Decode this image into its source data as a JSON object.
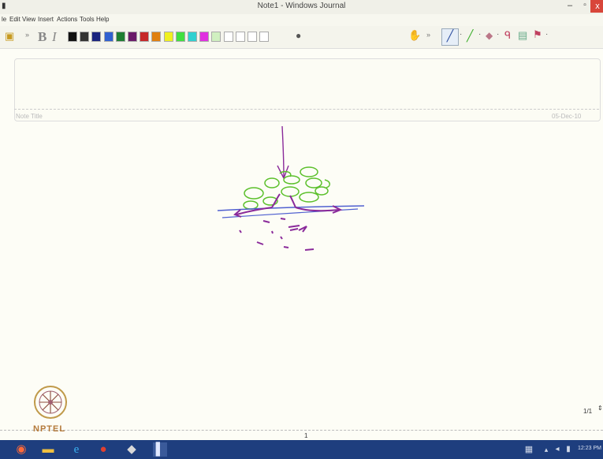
{
  "window": {
    "title": "Note1 - Windows Journal",
    "minimize": "–",
    "maximize": "▫",
    "close": "x"
  },
  "menu": [
    "le",
    "Edit",
    "View",
    "Insert",
    "Actions",
    "Tools",
    "Help"
  ],
  "toolbar": {
    "bold": "B",
    "italic": "I",
    "swatches": [
      "#111111",
      "#333333",
      "#1a237e",
      "#3060d0",
      "#1e7e32",
      "#6a1b6a",
      "#c62828",
      "#e08010",
      "#f0f020",
      "#40e040",
      "#30d0d0",
      "#e030e0",
      "#d0f0c0",
      "#ffffff",
      "#ffffff",
      "#ffffff",
      "#ffffff"
    ]
  },
  "note": {
    "title_placeholder": "Note Title",
    "date": "05-Dec-10"
  },
  "page": {
    "counter": "1/1",
    "number": "1"
  },
  "logo": {
    "text": "NPTEL"
  },
  "taskbar": {
    "clock": "12:23 PM"
  },
  "colors": {
    "green_ink": "#5cc02c",
    "purple_ink": "#8a2a9a",
    "blue_ink": "#5060d0",
    "taskbar": "#1e3e7e"
  }
}
